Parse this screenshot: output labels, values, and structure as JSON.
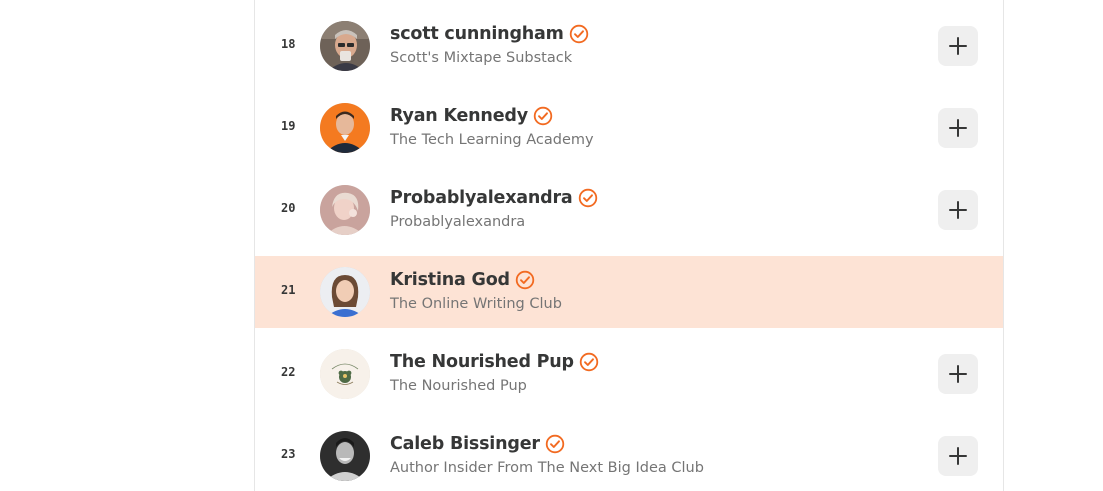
{
  "leaderboard": {
    "rows": [
      {
        "rank": "18",
        "name": "scott cunningham",
        "publication": "Scott's Mixtape Substack",
        "verified": true,
        "highlighted": false,
        "has_add_button": true,
        "avatar_icon": "avatar-photo-scott"
      },
      {
        "rank": "19",
        "name": "Ryan Kennedy",
        "publication": "The Tech Learning Academy",
        "verified": true,
        "highlighted": false,
        "has_add_button": true,
        "avatar_icon": "avatar-photo-ryan"
      },
      {
        "rank": "20",
        "name": "Probablyalexandra",
        "publication": "Probablyalexandra",
        "verified": true,
        "highlighted": false,
        "has_add_button": true,
        "avatar_icon": "avatar-photo-alexandra"
      },
      {
        "rank": "21",
        "name": "Kristina God",
        "publication": "The Online Writing Club",
        "verified": true,
        "highlighted": true,
        "has_add_button": false,
        "avatar_icon": "avatar-photo-kristina"
      },
      {
        "rank": "22",
        "name": "The Nourished Pup",
        "publication": "The Nourished Pup",
        "verified": true,
        "highlighted": false,
        "has_add_button": true,
        "avatar_icon": "avatar-logo-nourished-pup"
      },
      {
        "rank": "23",
        "name": "Caleb Bissinger",
        "publication": "Author Insider From The Next Big Idea Club",
        "verified": true,
        "highlighted": false,
        "has_add_button": true,
        "avatar_icon": "avatar-photo-caleb"
      }
    ]
  },
  "colors": {
    "accent": "#f26a21",
    "highlight_row": "#fde3d5",
    "name_text": "#363737",
    "subtitle_text": "#757575",
    "add_button_bg": "#efefef"
  },
  "icons": {
    "verified": "verified-check-circle-icon",
    "add": "plus-icon"
  }
}
